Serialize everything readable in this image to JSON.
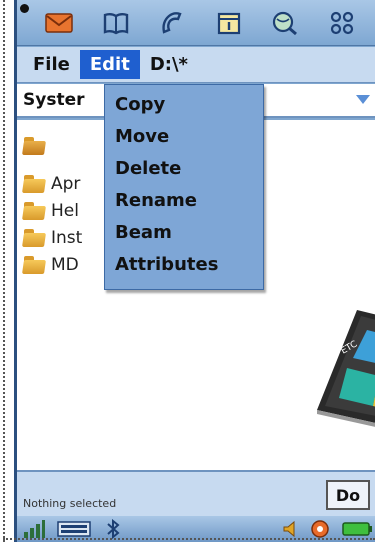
{
  "menubar": {
    "file_label": "File",
    "edit_label": "Edit",
    "path_label": "D:\\*"
  },
  "selector": {
    "value": "Syster"
  },
  "edit_menu": {
    "items": [
      "Copy",
      "Move",
      "Delete",
      "Rename",
      "Beam",
      "Attributes"
    ]
  },
  "files": {
    "items": [
      {
        "label": "Apr"
      },
      {
        "label": "Hel"
      },
      {
        "label": "Inst"
      },
      {
        "label": "MD"
      }
    ]
  },
  "status": {
    "text": "Nothing selected",
    "do_label": "Do"
  },
  "colors": {
    "accent": "#1f5fcf",
    "menu_bg": "#7ea6d6",
    "bar_bg": "#c7daf0"
  },
  "icons": {
    "appbar": [
      "mail-icon",
      "book-icon",
      "phone-icon",
      "calendar-icon",
      "search-globe-icon",
      "apps-grid-icon"
    ],
    "tray": [
      "signal-icon",
      "keyboard-icon",
      "bluetooth-icon",
      "volume-icon",
      "record-icon",
      "battery-icon"
    ]
  }
}
